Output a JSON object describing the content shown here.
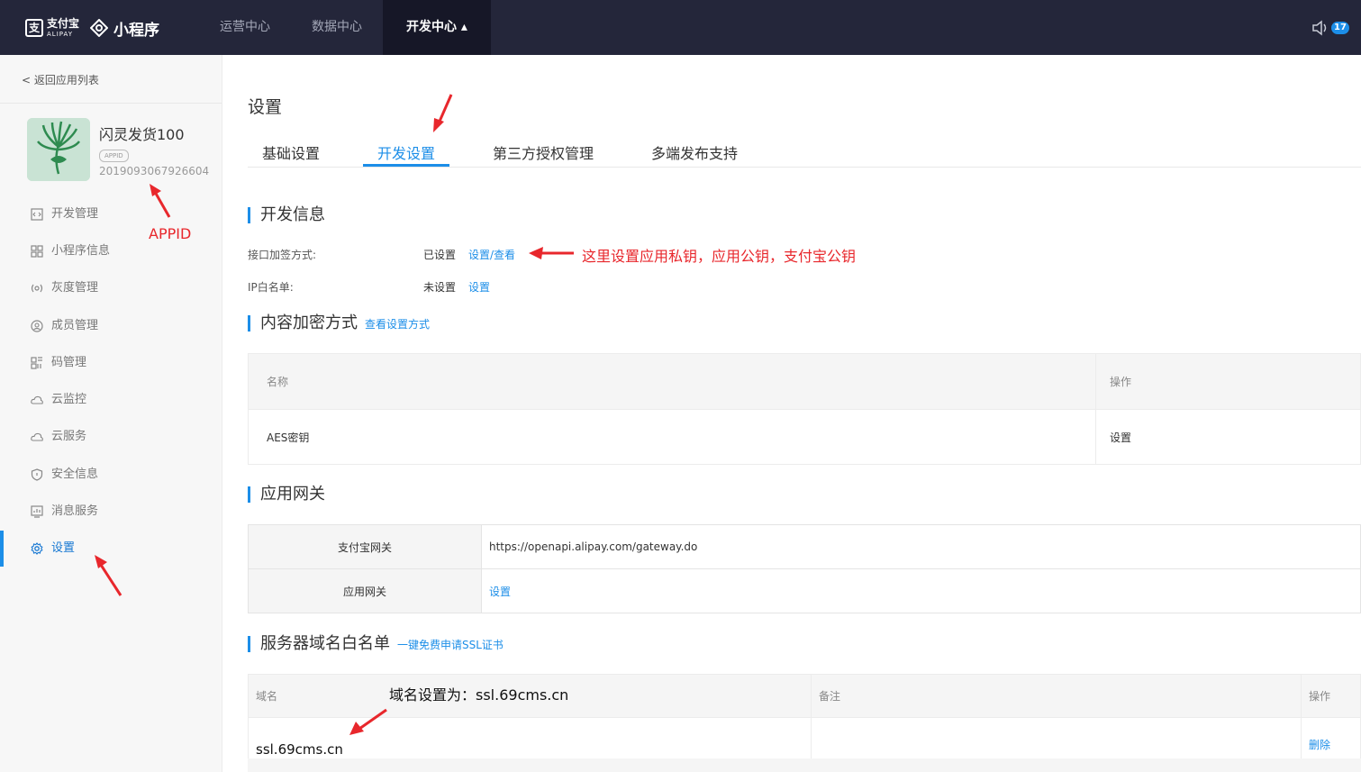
{
  "header": {
    "brand_cn": "支付宝",
    "brand_en": "ALIPAY",
    "product": "小程序",
    "nav": [
      {
        "label": "运营中心"
      },
      {
        "label": "数据中心"
      },
      {
        "label": "开发中心 ▴"
      }
    ],
    "notification_count": "17",
    "speaker_icon": "speaker-icon"
  },
  "sidebar": {
    "back": "< 返回应用列表",
    "app_name": "闪灵发货100",
    "appid_tag": "APPID",
    "appid": "2019093067926604",
    "items": [
      {
        "label": "开发管理",
        "icon": "code-icon"
      },
      {
        "label": "小程序信息",
        "icon": "grid-icon"
      },
      {
        "label": "灰度管理",
        "icon": "signal-icon"
      },
      {
        "label": "成员管理",
        "icon": "user-icon"
      },
      {
        "label": "码管理",
        "icon": "qrcode-icon"
      },
      {
        "label": "云监控",
        "icon": "cloud-icon"
      },
      {
        "label": "云服务",
        "icon": "cloud-icon"
      },
      {
        "label": "安全信息",
        "icon": "shield-icon"
      },
      {
        "label": "消息服务",
        "icon": "chart-icon"
      },
      {
        "label": "设置",
        "icon": "gear-icon"
      }
    ]
  },
  "main": {
    "title": "设置",
    "tabs": [
      {
        "label": "基础设置"
      },
      {
        "label": "开发设置"
      },
      {
        "label": "第三方授权管理"
      },
      {
        "label": "多端发布支持"
      }
    ],
    "dev_info": {
      "title": "开发信息",
      "sign_label": "接口加签方式:",
      "sign_status": "已设置",
      "sign_link": "设置/查看",
      "ip_label": "IP白名单:",
      "ip_status": "未设置",
      "ip_link": "设置"
    },
    "content_encrypt": {
      "title": "内容加密方式",
      "link": "查看设置方式",
      "headers": [
        "名称",
        "操作"
      ],
      "rows": [
        {
          "name": "AES密钥",
          "action": "设置"
        }
      ]
    },
    "gateway": {
      "title": "应用网关",
      "rows": [
        {
          "label": "支付宝网关",
          "value": "https://openapi.alipay.com/gateway.do"
        },
        {
          "label": "应用网关",
          "value": "设置"
        }
      ]
    },
    "domain": {
      "title": "服务器域名白名单",
      "link": "一键免费申请SSL证书",
      "headers": [
        "域名",
        "备注",
        "操作"
      ],
      "rows": [
        {
          "domain": "ssl.69cms.cn",
          "remark": "",
          "action": "删除"
        }
      ]
    }
  },
  "annotations": {
    "appid": "APPID",
    "keys": "这里设置应用私钥，应用公钥，支付宝公钥",
    "domain": "域名设置为：ssl.69cms.cn"
  },
  "colors": {
    "accent": "#1c8ee8",
    "topbar": "#24263a",
    "annotation": "#e8272c"
  }
}
